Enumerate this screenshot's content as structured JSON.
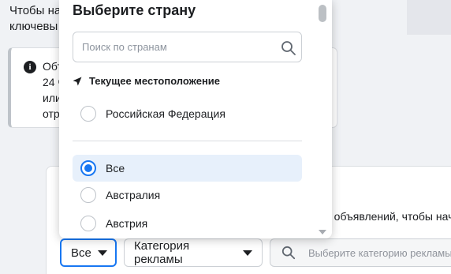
{
  "background": {
    "intro_lines": [
      "Чтобы на",
      "ключевы"
    ],
    "info_lines": [
      "Объ",
      "24 ч",
      "или",
      "отра"
    ],
    "card_text": "о объявлений, чтобы нач",
    "filters": {
      "all_label": "Все",
      "category_label": "Категория рекламы",
      "category_search_placeholder": "Выберите категорию рекламы"
    }
  },
  "dropdown": {
    "title": "Выберите страну",
    "search_placeholder": "Поиск по странам",
    "current_location_label": "Текущее местоположение",
    "current_location_option": "Российская Федерация",
    "options": [
      {
        "label": "Все",
        "selected": true
      },
      {
        "label": "Австралия",
        "selected": false
      },
      {
        "label": "Австрия",
        "selected": false
      }
    ]
  },
  "colors": {
    "accent": "#1877f2",
    "selected_row": "#e7f0fb"
  },
  "icons": [
    "search-icon",
    "location-arrow-icon",
    "info-icon",
    "chevron-down-icon"
  ]
}
